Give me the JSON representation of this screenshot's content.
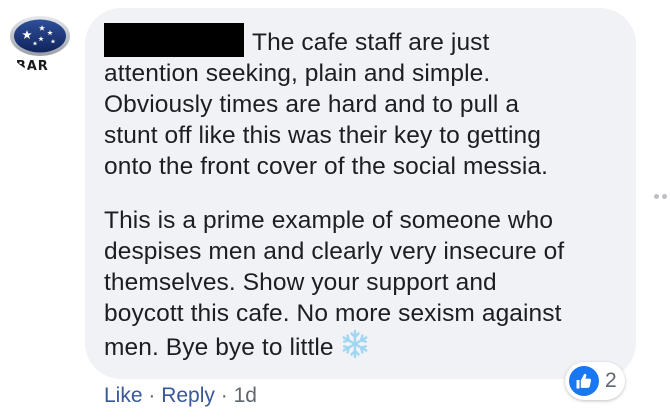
{
  "commenter": {
    "avatar_logo": "subaru-logo",
    "avatar_text": "IBAR"
  },
  "comment": {
    "paragraph1": [
      "The cafe staff are just",
      "attention seeking, plain and simple.",
      "Obviously times are hard and to pull a",
      "stunt off like this was their key to getting",
      "onto the front cover of the social messia."
    ],
    "paragraph2": [
      "This is a prime example of someone who",
      "despises men and clearly very insecure of",
      "themselves. Show your support and",
      "boycott this cafe. No more sexism against",
      "men. Bye bye to little"
    ],
    "emoji": "snowflake-icon"
  },
  "actions": {
    "like_label": "Like",
    "separator": "·",
    "reply_label": "Reply",
    "timestamp": "1d"
  },
  "reactions": {
    "icon": "thumbs-up-icon",
    "count": "2"
  },
  "colors": {
    "bubble": "#f0f2f5",
    "text": "#1c1e21",
    "link": "#385898",
    "meta": "#606770",
    "like_blue": "#1877f2",
    "redaction": "#000000"
  }
}
